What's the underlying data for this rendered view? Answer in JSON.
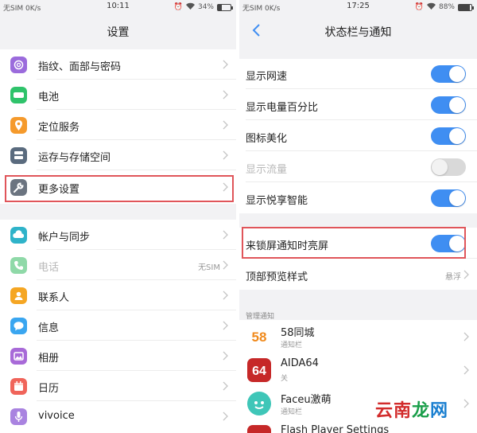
{
  "left": {
    "status": {
      "carrier": "无SIM 0K/s",
      "time": "10:11",
      "battery": "34%",
      "battery_level": 0.34
    },
    "title": "设置",
    "group1": [
      {
        "label": "指纹、面部与密码",
        "icon": "fingerprint-icon",
        "color": "#9b6bdc"
      },
      {
        "label": "电池",
        "icon": "battery-icon",
        "color": "#2fc36b"
      },
      {
        "label": "定位服务",
        "icon": "location-icon",
        "color": "#f59a2c"
      },
      {
        "label": "运存与存储空间",
        "icon": "storage-icon",
        "color": "#5a6b7e"
      },
      {
        "label": "更多设置",
        "icon": "wrench-icon",
        "color": "#6b7480"
      }
    ],
    "group2": [
      {
        "label": "帐户与同步",
        "icon": "cloud-sync-icon",
        "color": "#2fb3c9"
      },
      {
        "label": "电话",
        "icon": "phone-icon",
        "color": "#8fd9a8",
        "value": "无SIM",
        "dim": true
      },
      {
        "label": "联系人",
        "icon": "contacts-icon",
        "color": "#f5a623"
      },
      {
        "label": "信息",
        "icon": "message-icon",
        "color": "#3aa6f0"
      },
      {
        "label": "相册",
        "icon": "gallery-icon",
        "color": "#a86ad8"
      },
      {
        "label": "日历",
        "icon": "calendar-icon",
        "color": "#f0645a"
      },
      {
        "label": "vivoice",
        "icon": "mic-icon",
        "color": "#a983e0"
      }
    ]
  },
  "right": {
    "status": {
      "carrier": "无SIM 0K/s",
      "time": "17:25",
      "battery": "88%",
      "battery_level": 0.88
    },
    "title": "状态栏与通知",
    "toggles": [
      {
        "label": "显示网速",
        "on": true
      },
      {
        "label": "显示电量百分比",
        "on": true
      },
      {
        "label": "图标美化",
        "on": true
      },
      {
        "label": "显示流量",
        "on": false,
        "dim": true
      },
      {
        "label": "显示悦享智能",
        "on": true
      }
    ],
    "lock_notify": {
      "label": "来锁屏通知时亮屏",
      "on": true
    },
    "top_preview": {
      "label": "顶部预览样式",
      "value": "悬浮"
    },
    "section_label": "管理通知",
    "apps": [
      {
        "name": "58同城",
        "sub": "通知栏",
        "icon": "58-app-icon"
      },
      {
        "name": "AIDA64",
        "sub": "关",
        "icon": "aida64-app-icon"
      },
      {
        "name": "Faceu激萌",
        "sub": "通知栏",
        "icon": "faceu-app-icon"
      },
      {
        "name": "Flash Player Settings",
        "sub": "",
        "icon": "flash-app-icon"
      }
    ],
    "icon_text": {
      "app58": "58",
      "aida": "64"
    }
  },
  "watermark": {
    "text": "云南龙网",
    "colors": [
      "#d22b2b",
      "#d22b2b",
      "#1a9e4a",
      "#1a7fd0"
    ]
  },
  "colors": {
    "accent": "#3f8ef2",
    "highlight": "#e0555a"
  }
}
